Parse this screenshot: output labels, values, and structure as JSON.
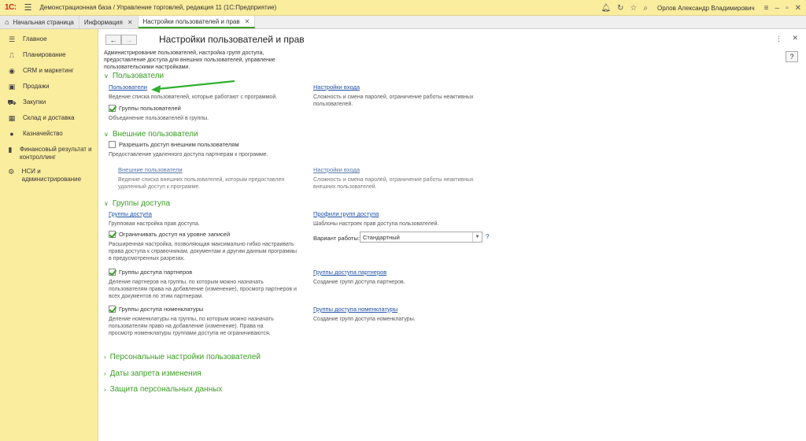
{
  "titlebar": {
    "logo": "1С:",
    "title": "Демонстрационная база / Управление торговлей, редакция 11  (1С:Предприятие)",
    "user": "Орлов Александр Владимирович"
  },
  "tabs": [
    {
      "label": "Начальная страница"
    },
    {
      "label": "Информация"
    },
    {
      "label": "Настройки пользователей и прав"
    }
  ],
  "sidebar": {
    "items": [
      {
        "label": "Главное",
        "icon": "menu-icon"
      },
      {
        "label": "Планирование",
        "icon": "planning-icon"
      },
      {
        "label": "CRM и маркетинг",
        "icon": "crm-icon"
      },
      {
        "label": "Продажи",
        "icon": "sales-icon"
      },
      {
        "label": "Закупки",
        "icon": "cart-icon"
      },
      {
        "label": "Склад и доставка",
        "icon": "warehouse-icon"
      },
      {
        "label": "Казначейство",
        "icon": "treasury-icon"
      },
      {
        "label": "Финансовый результат и контроллинг",
        "icon": "chart-icon"
      },
      {
        "label": "НСИ и администрирование",
        "icon": "gear-icon"
      }
    ]
  },
  "main": {
    "title": "Настройки пользователей и прав",
    "intro": "Администрирование пользователей, настройка групп доступа, предоставление доступа для внешних пользователей, управление пользовательскими настройками.",
    "sections": {
      "users": "Пользователи",
      "external": "Внешние пользователи",
      "access": "Группы доступа",
      "personal": "Персональные настройки пользователей",
      "dates": "Даты запрета изменения",
      "personal_data": "Защита персональных данных"
    },
    "users": {
      "link": "Пользователи",
      "desc": "Ведение списка пользователей, которые работают с программой.",
      "groups_check": "Группы пользователей",
      "groups_desc": "Объединение пользователей в группы.",
      "login_link": "Настройки входа",
      "login_desc": "Сложность и смена паролей, ограничение работы неактивных пользователей."
    },
    "external": {
      "allow_check": "Разрешить доступ внешним пользователям",
      "allow_desc": "Предоставление удаленного доступа партнерам к программе.",
      "link": "Внешние пользователи",
      "desc": "Ведение списка внешних пользователей, которым предоставлен удаленный доступ к программе.",
      "login_link": "Настройки входа",
      "login_desc": "Сложность и смена паролей, ограничение работы неактивных внешних пользователей."
    },
    "access": {
      "groups_link": "Группы доступа",
      "groups_desc": "Групповая настройка прав доступа.",
      "profiles_link": "Профили групп доступа",
      "profiles_desc": "Шаблоны настроек прав доступа пользователей.",
      "restrict_check": "Ограничивать доступ на уровне записей",
      "restrict_desc": "Расширенная настройка, позволяющая максимально гибко настраивать права доступа к справочникам, документам и другим данным программы в предусмотренных разрезах.",
      "variant_label": "Вариант работы:",
      "variant_value": "Стандартный",
      "partners_check": "Группы доступа партнеров",
      "partners_desc": "Деление партнеров на группы, по которым можно назначать пользователям права на добавление (изменение), просмотр партнеров и всех документов по этим партнерам.",
      "partners_link": "Группы доступа партнеров",
      "partners_link_desc": "Создание групп доступа партнеров.",
      "nomen_check": "Группы доступа номенклатуры",
      "nomen_desc": "Деление номенклатуры на группы, по которым можно назначать пользователям право на добавление (изменение). Права на просмотр номенклатуры группами доступа не ограничиваются.",
      "nomen_link": "Группы доступа номенклатуры",
      "nomen_link_desc": "Создание групп доступа номенклатуры."
    }
  },
  "colors": {
    "accent": "#3a9d23",
    "panel": "#fbed9e",
    "link": "#1f4fa8"
  }
}
